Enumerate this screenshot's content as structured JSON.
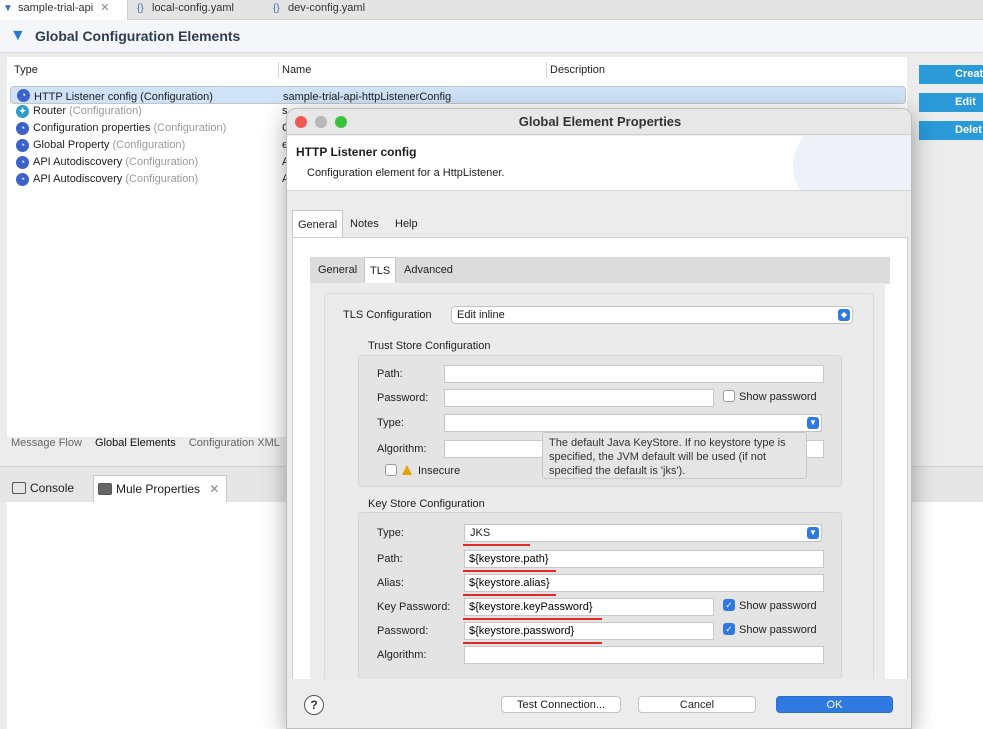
{
  "editor_tabs": [
    {
      "label": "sample-trial-api",
      "close": "✕"
    },
    {
      "label": "local-config.yaml",
      "icon": "{}"
    },
    {
      "label": "dev-config.yaml",
      "icon": "{}"
    }
  ],
  "header": {
    "title": "Global Configuration Elements"
  },
  "table": {
    "columns": [
      "Type",
      "Name",
      "Description"
    ],
    "rows": [
      {
        "type": "HTTP Listener config (Configuration)",
        "category": "",
        "name": "sample-trial-api-httpListenerConfig",
        "icon": "gear-icon"
      },
      {
        "type": "Router",
        "category": "(Configuration)",
        "name": "s",
        "icon": "router-icon"
      },
      {
        "type": "Configuration properties",
        "category": "(Configuration)",
        "name": "C",
        "icon": "gear-icon"
      },
      {
        "type": "Global Property",
        "category": "(Configuration)",
        "name": "e",
        "icon": "gear-icon"
      },
      {
        "type": "API Autodiscovery",
        "category": "(Configuration)",
        "name": "A",
        "icon": "gear-icon"
      },
      {
        "type": "API Autodiscovery",
        "category": "(Configuration)",
        "name": "A",
        "icon": "gear-icon"
      }
    ]
  },
  "side_buttons": [
    "Creat",
    "Edit",
    "Delet"
  ],
  "bottom_tabs": [
    "Message Flow",
    "Global Elements",
    "Configuration XML"
  ],
  "console_tabs": [
    "Console",
    "Mule Properties"
  ],
  "dialog": {
    "title": "Global Element Properties",
    "heading": "HTTP Listener config",
    "description": "Configuration element for a HttpListener.",
    "tabs": [
      "General",
      "Notes",
      "Help"
    ],
    "subtabs": [
      "General",
      "TLS",
      "Advanced"
    ],
    "tls_label": "TLS Configuration",
    "tls_value": "Edit inline",
    "trust_store": {
      "title": "Trust Store Configuration",
      "path_label": "Path:",
      "password_label": "Password:",
      "show_password": "Show password",
      "type_label": "Type:",
      "algorithm_label": "Algorithm:",
      "insecure_label": "Insecure"
    },
    "tooltip": "The default Java KeyStore. If no keystore type is specified, the JVM default will be used (if not specified the default is 'jks').",
    "key_store": {
      "title": "Key Store Configuration",
      "type_label": "Type:",
      "type_value": "JKS",
      "path_label": "Path:",
      "path_value": "${keystore.path}",
      "alias_label": "Alias:",
      "alias_value": "${keystore.alias}",
      "key_password_label": "Key Password:",
      "key_password_value": "${keystore.keyPassword}",
      "password_label": "Password:",
      "password_value": "${keystore.password}",
      "show_password": "Show password",
      "algorithm_label": "Algorithm:"
    },
    "buttons": {
      "help": "?",
      "test": "Test Connection...",
      "cancel": "Cancel",
      "ok": "OK"
    }
  }
}
